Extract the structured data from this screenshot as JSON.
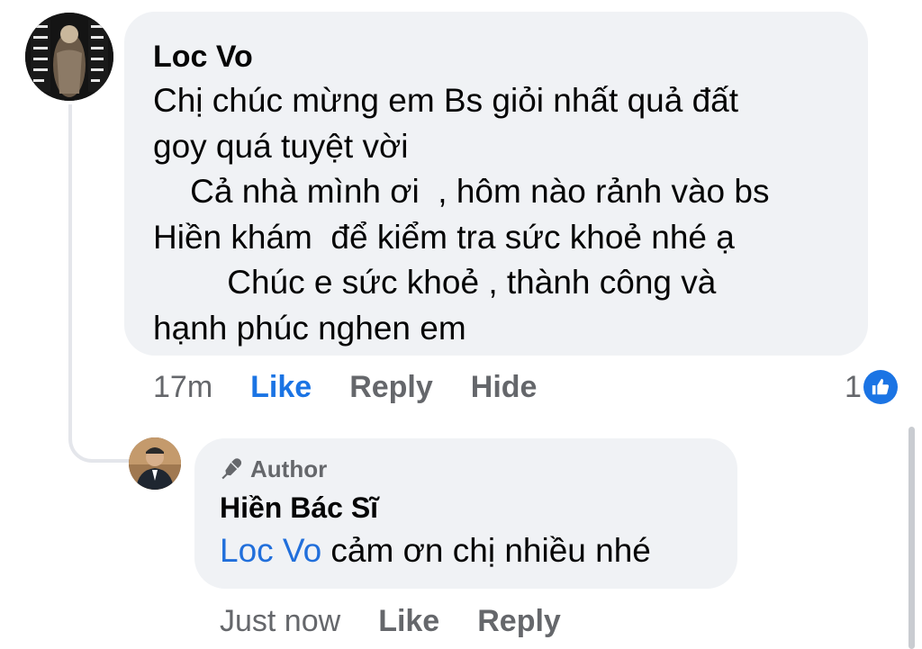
{
  "comment": {
    "author": "Loc Vo",
    "text": "Chị chúc mừng em Bs giỏi nhất quả đất\ngoy quá tuyệt vời\n    Cả nhà mình ơi  , hôm nào rảnh vào bs\nHiền khám  để kiểm tra sức khoẻ nhé ạ\n        Chúc e sức khoẻ , thành công và\nhạnh phúc nghen em",
    "time": "17m",
    "actions": {
      "like": "Like",
      "reply": "Reply",
      "hide": "Hide"
    },
    "reaction_count": "1"
  },
  "reply": {
    "badge": "Author",
    "author": "Hiền Bác Sĩ",
    "mention": "Loc Vo",
    "text": " cảm ơn chị nhiều nhé",
    "time": "Just now",
    "actions": {
      "like": "Like",
      "reply": "Reply"
    }
  },
  "colors": {
    "bubble": "#f0f2f5",
    "link_blue": "#1b74e4",
    "secondary_text": "#65676b"
  }
}
